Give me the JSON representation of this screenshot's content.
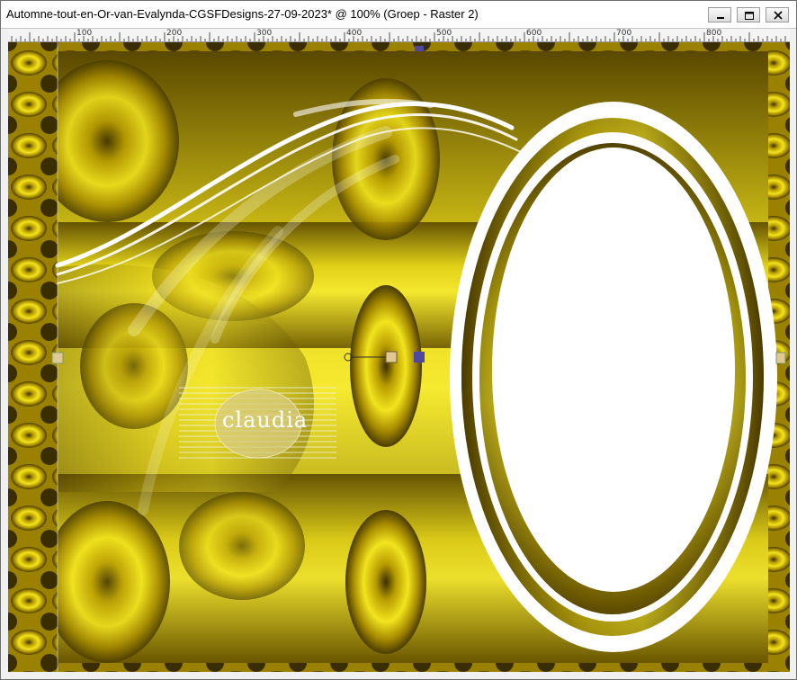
{
  "window": {
    "title": "Automne-tout-en-Or-van-Evalynda-CGSFDesigns-27-09-2023* @ 100% (Groep - Raster 2)"
  },
  "ruler": {
    "labels": [
      "100",
      "200",
      "300",
      "400",
      "500",
      "600",
      "700",
      "800"
    ]
  },
  "watermark": {
    "text": "claudia"
  },
  "colors": {
    "gold_light": "#e8d820",
    "gold_mid": "#b89c00",
    "gold_dark": "#3a2e00",
    "white": "#ffffff",
    "handle_blue": "#5048a0",
    "handle_tan": "#e0c890"
  }
}
